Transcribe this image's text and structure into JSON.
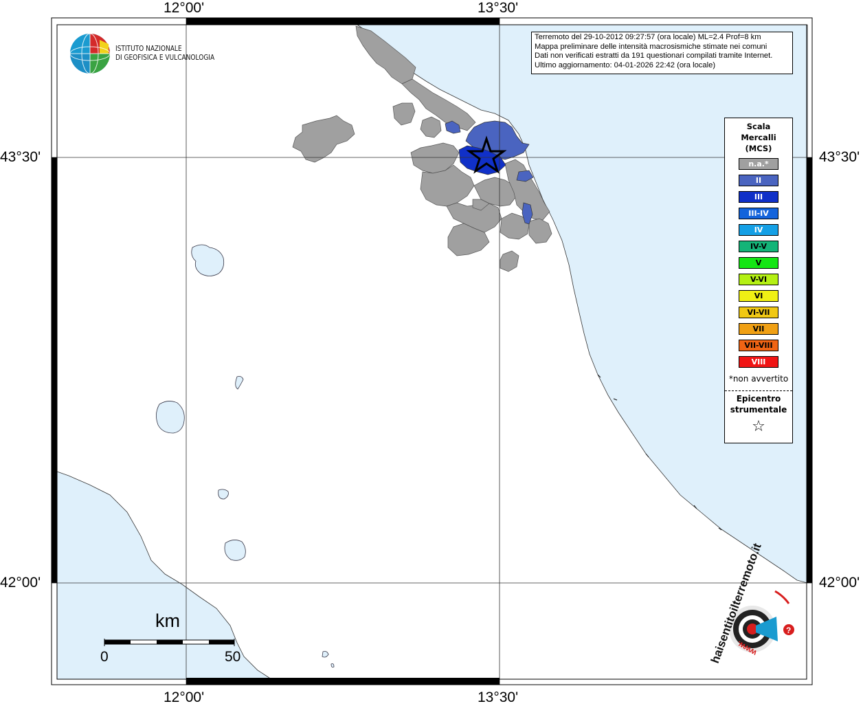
{
  "axes": {
    "top_labels": [
      "12°00'",
      "13°30'"
    ],
    "bottom_labels": [
      "12°00'",
      "13°30'"
    ],
    "left_labels": [
      "43°30'",
      "42°00'"
    ],
    "right_labels": [
      "43°30'",
      "42°00'"
    ]
  },
  "info_box": {
    "line1": "Terremoto del 29-10-2012 09:27:57 (ora locale) ML=2.4 Prof=8 km",
    "line2": "Mappa preliminare delle intensità macrosismiche stimate nei comuni",
    "line3": "Dati non verificati estratti da 191 questionari compilati tramite Internet.",
    "line4": "Ultimo aggiornamento: 04-01-2026 22:42 (ora locale)"
  },
  "logo": {
    "line1": "ISTITUTO NAZIONALE",
    "line2": "DI GEOFISICA E VULCANOLOGIA"
  },
  "legend": {
    "title1": "Scala",
    "title2": "Mercalli",
    "title3": "(MCS)",
    "items": [
      {
        "label": "n.a.*",
        "color": "#a0a0a0"
      },
      {
        "label": "II",
        "color": "#4a64c0"
      },
      {
        "label": "III",
        "color": "#1030c8"
      },
      {
        "label": "III-IV",
        "color": "#1464dc"
      },
      {
        "label": "IV",
        "color": "#14a0e6"
      },
      {
        "label": "IV-V",
        "color": "#14b478"
      },
      {
        "label": "V",
        "color": "#14e614"
      },
      {
        "label": "V-VI",
        "color": "#b4f014"
      },
      {
        "label": "VI",
        "color": "#f0f014"
      },
      {
        "label": "VI-VII",
        "color": "#f0c814"
      },
      {
        "label": "VII",
        "color": "#f0a014"
      },
      {
        "label": "VII-VIII",
        "color": "#f06414"
      },
      {
        "label": "VIII",
        "color": "#f01414"
      }
    ],
    "note": "*non avvertito",
    "epicenter_line1": "Epicentro",
    "epicenter_line2": "strumentale",
    "epicenter_symbol": "☆"
  },
  "scale_bar": {
    "unit": "km",
    "start": "0",
    "end": "50"
  },
  "hsit_logo": {
    "text": "haisentitoilterremoto.it",
    "www": "www.",
    "q": "?"
  },
  "colors": {
    "sea": "#dff0fb",
    "land": "#ffffff",
    "na_gray": "#a0a0a0",
    "intensity_ii": "#4a64c0",
    "intensity_iii": "#1030c8"
  }
}
